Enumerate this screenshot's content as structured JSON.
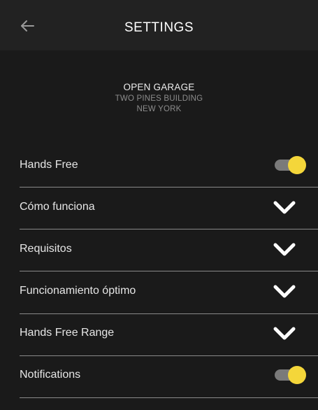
{
  "header": {
    "back_icon": "arrow-left-icon",
    "title": "SETTINGS"
  },
  "device": {
    "name": "OPEN GARAGE",
    "building": "TWO PINES BUILDING",
    "city": "NEW YORK"
  },
  "settings": {
    "items": [
      {
        "label": "Hands Free",
        "control": "toggle",
        "on": true
      },
      {
        "label": "Cómo funciona",
        "control": "chevron-down-icon"
      },
      {
        "label": "Requisitos",
        "control": "chevron-down-icon"
      },
      {
        "label": "Funcionamiento óptimo",
        "control": "chevron-down-icon"
      },
      {
        "label": "Hands Free Range",
        "control": "chevron-down-icon"
      },
      {
        "label": "Notifications",
        "control": "toggle",
        "on": true
      }
    ]
  },
  "colors": {
    "background": "#1a1a1a",
    "appbar": "#222222",
    "toggle_knob": "#f4d63a",
    "toggle_track": "#7a7a7a",
    "divider": "#8a8a8a"
  }
}
